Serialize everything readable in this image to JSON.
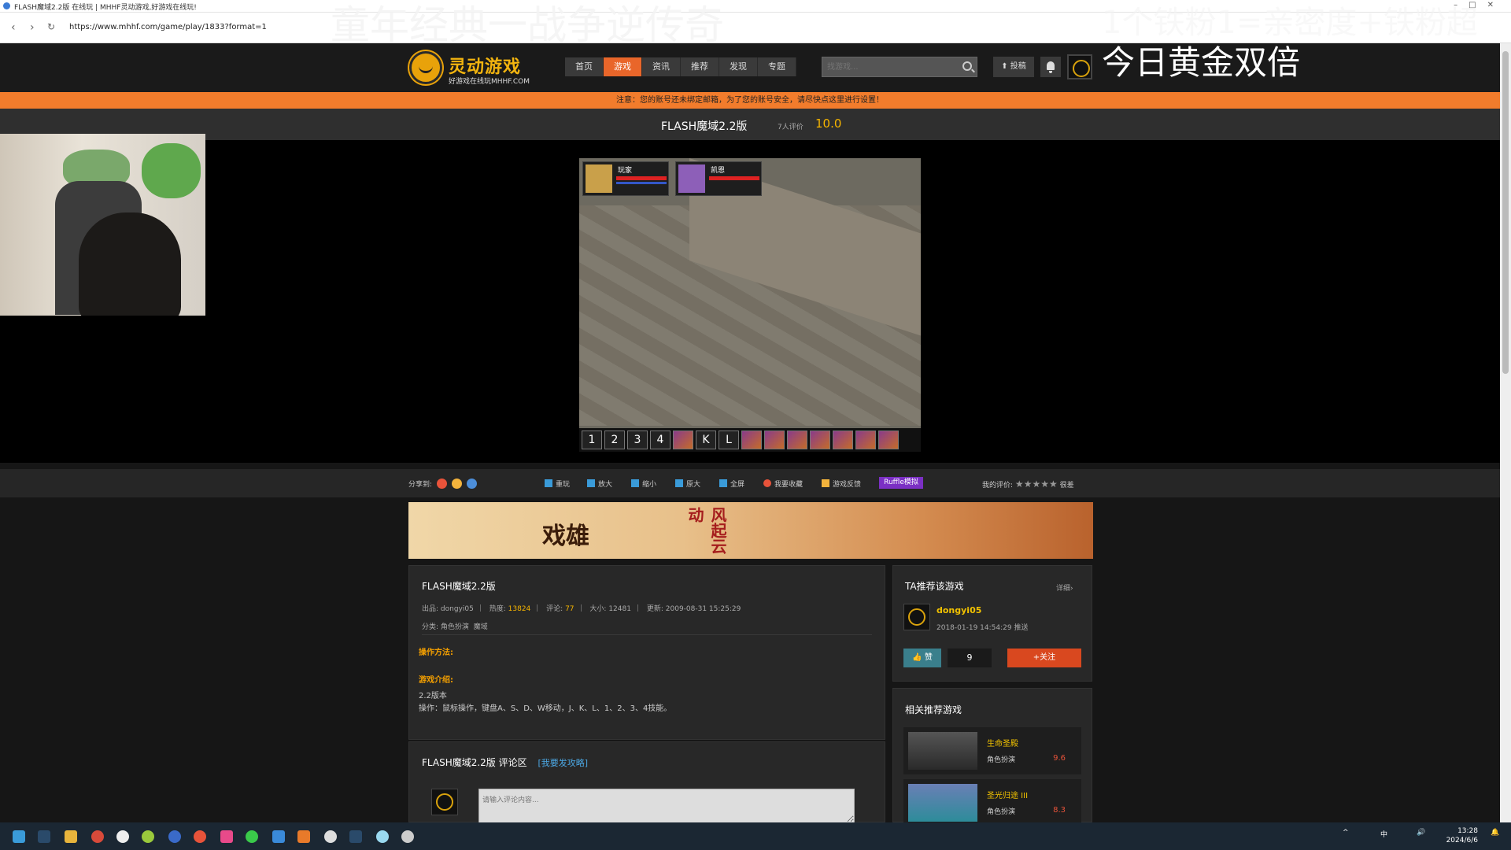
{
  "browser": {
    "tab_title": "FLASH魔域2.2版 在线玩 | MHHF灵动游戏,好游戏在线玩!",
    "url": "https://www.mhhf.com/game/play/1833?format=1"
  },
  "stream_overlay": {
    "top_left_text": "童年经典一战争逆传奇",
    "top_right_text": "1个铁粉1=亲密度+铁粉超",
    "right_text": "今日黄金双倍"
  },
  "site": {
    "logo_name": "灵动游戏",
    "logo_sub": "好游戏在线玩MHHF.COM",
    "nav": [
      "首页",
      "游戏",
      "资讯",
      "推荐",
      "发现",
      "专题"
    ],
    "nav_active": "游戏",
    "search_placeholder": "找游戏...",
    "post_label": "投稿",
    "notice": "注意：您的账号还未绑定邮箱，为了您的账号安全，请尽快点这里进行设置！"
  },
  "game": {
    "title": "FLASH魔域2.2版",
    "rating_count": "7人评价",
    "score": "10.0",
    "hud_player": "玩家",
    "hud_target": "凯恩",
    "skill_keys": [
      "1",
      "2",
      "3",
      "4",
      "",
      "K",
      "L",
      "",
      "",
      "",
      "",
      "",
      "",
      "",
      ""
    ]
  },
  "toolbar": {
    "share_label": "分享到:",
    "replay": "重玩",
    "zoom_in": "放大",
    "zoom_out": "缩小",
    "original": "原大",
    "fullscreen": "全屏",
    "favorite": "我要收藏",
    "feedback": "游戏反馈",
    "ruffle": "Ruffle模拟",
    "my_rating": "我的评价:",
    "rating_word": "很差"
  },
  "info": {
    "title": "FLASH魔域2.2版",
    "publisher_label": "出品:",
    "publisher": "dongyi05",
    "heat_label": "热度:",
    "heat": "13824",
    "comments_label": "评论:",
    "comments": "77",
    "size_label": "大小:",
    "size": "12481",
    "updated_label": "更新:",
    "updated": "2009-08-31 15:25:29",
    "category_label": "分类:",
    "category1": "角色扮演",
    "category2": "魔域",
    "howto_label": "操作方法:",
    "intro_label": "游戏介绍:",
    "intro_line1": "2.2版本",
    "intro_line2": "操作：鼠标操作，键盘A、S、D、W移动，J、K、L、1、2、3、4技能。"
  },
  "comments_panel": {
    "title": "FLASH魔域2.2版 评论区",
    "strategy_link": "[我要发攻略]",
    "input_placeholder": "请输入评论内容..."
  },
  "recommend": {
    "title": "TA推荐该游戏",
    "more": "详细›",
    "user": "dongyi05",
    "time": "2018-01-19 14:54:29 推送",
    "like_label": "赞",
    "like_count": "9",
    "follow_label": "+关注"
  },
  "related": {
    "title": "相关推荐游戏",
    "items": [
      {
        "name": "生命圣殿",
        "category": "角色扮演",
        "score": "9.6"
      },
      {
        "name": "圣光归途 III",
        "category": "角色扮演",
        "score": "8.3"
      }
    ]
  },
  "taskbar": {
    "ime": "中",
    "time": "13:28",
    "date": "2024/6/6"
  }
}
